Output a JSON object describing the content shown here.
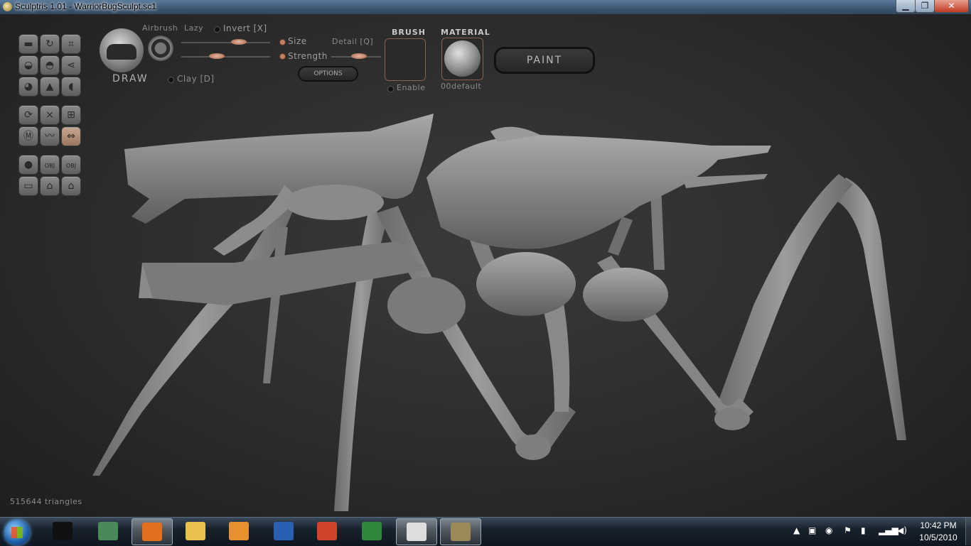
{
  "window": {
    "title": "Sculptris 1.01 - WarriorBugSculpt.sc1",
    "min_label": "▁",
    "max_label": "❐",
    "close_label": "✕"
  },
  "toolbar": {
    "mode_label": "DRAW",
    "airbrush_label": "Airbrush",
    "lazy_label": "Lazy",
    "invert_label": "Invert [X]",
    "size_label": "Size",
    "strength_label": "Strength",
    "detail_label": "Detail [Q]",
    "clay_label": "Clay [D]",
    "options_label": "OPTIONS",
    "size_value": 0.65,
    "strength_value": 0.4,
    "detail_value": 0.55
  },
  "brush": {
    "header": "BRUSH",
    "enable_label": "Enable"
  },
  "material": {
    "header": "MATERIAL",
    "name": "00default"
  },
  "paint_button": "PAINT",
  "tool_buttons": [
    {
      "name": "tool-crease-icon",
      "glyph": "▬"
    },
    {
      "name": "tool-rotate-icon",
      "glyph": "↻"
    },
    {
      "name": "tool-crop-icon",
      "glyph": "⌗"
    },
    {
      "name": "tool-flatten-icon",
      "glyph": "◒"
    },
    {
      "name": "tool-inflate-icon",
      "glyph": "◓"
    },
    {
      "name": "tool-pinch-icon",
      "glyph": "⋖"
    },
    {
      "name": "tool-grab-icon",
      "glyph": "◕"
    },
    {
      "name": "tool-smooth-icon",
      "glyph": "▲"
    },
    {
      "name": "tool-scale-icon",
      "glyph": "◖"
    },
    {
      "name": "tool-reduce-icon",
      "glyph": "⟳"
    },
    {
      "name": "tool-wireframe-icon",
      "glyph": "⨯"
    },
    {
      "name": "tool-grid-icon",
      "glyph": "⊞"
    },
    {
      "name": "tool-mask-icon",
      "glyph": "Ⓜ"
    },
    {
      "name": "tool-waves-icon",
      "glyph": "〰"
    },
    {
      "name": "tool-symmetry-icon",
      "glyph": "⇔"
    },
    {
      "name": "tool-sphere-icon",
      "glyph": "●"
    },
    {
      "name": "tool-import-obj-icon",
      "glyph": "OBJ"
    },
    {
      "name": "tool-export-obj-icon",
      "glyph": "OBJ"
    },
    {
      "name": "tool-plane-icon",
      "glyph": "▭"
    },
    {
      "name": "tool-open-icon",
      "glyph": "⌂"
    },
    {
      "name": "tool-save-icon",
      "glyph": "⌂"
    }
  ],
  "status": {
    "triangles": "515644 triangles"
  },
  "taskbar": {
    "apps": [
      {
        "name": "cmd-icon",
        "color": "#111111"
      },
      {
        "name": "task-manager-icon",
        "color": "#4a8a5a"
      },
      {
        "name": "firefox-icon",
        "color": "#e07020"
      },
      {
        "name": "explorer-icon",
        "color": "#e8c050"
      },
      {
        "name": "media-player-icon",
        "color": "#e89030"
      },
      {
        "name": "word-icon",
        "color": "#2b5fb4"
      },
      {
        "name": "outlook-icon",
        "color": "#d0452a"
      },
      {
        "name": "excel-icon",
        "color": "#2e8a3a"
      },
      {
        "name": "xsi-icon",
        "color": "#dddddd"
      },
      {
        "name": "sculptris-icon",
        "color": "#9a8a5a"
      }
    ],
    "time": "10:42 PM",
    "date": "10/5/2010"
  },
  "colors": {
    "accent_orange": "#c08060",
    "model_gray": "#8a8a8a"
  }
}
